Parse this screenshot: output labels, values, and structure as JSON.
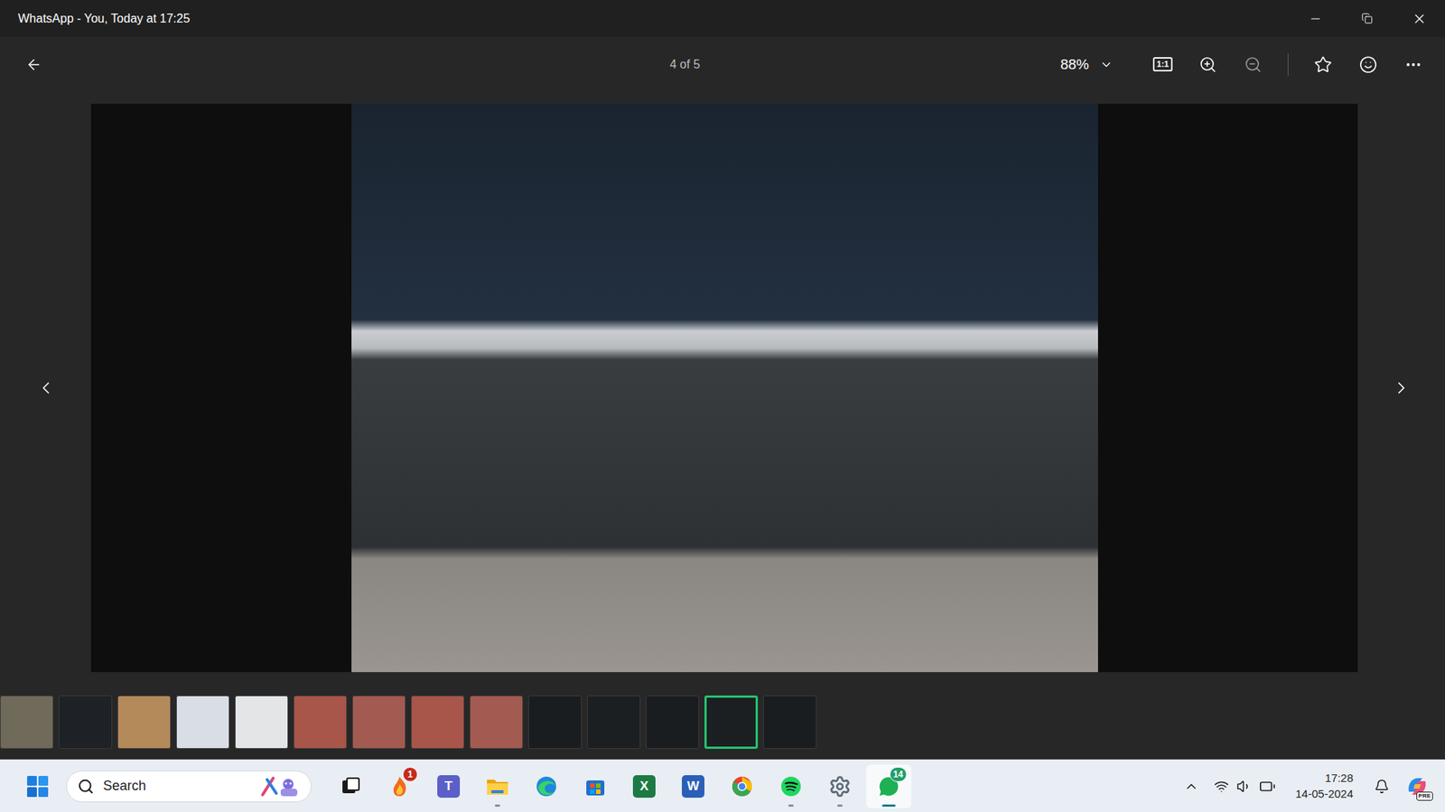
{
  "window": {
    "title": "WhatsApp - You, Today at 17:25"
  },
  "toolbar": {
    "position": "4 of 5",
    "zoom": "88%",
    "actual_size": "1:1"
  },
  "thumbnails": [
    {
      "selected": false,
      "color": "#6f6a5a"
    },
    {
      "selected": false,
      "color": "#1e2226"
    },
    {
      "selected": false,
      "color": "#b58a5a"
    },
    {
      "selected": false,
      "color": "#d8dde6"
    },
    {
      "selected": false,
      "color": "#e3e5e7"
    },
    {
      "selected": false,
      "color": "#a8554a"
    },
    {
      "selected": false,
      "color": "#a35a50"
    },
    {
      "selected": false,
      "color": "#a8554a"
    },
    {
      "selected": false,
      "color": "#a35a50"
    },
    {
      "selected": false,
      "color": "#1a1d20"
    },
    {
      "selected": false,
      "color": "#1c1f22"
    },
    {
      "selected": false,
      "color": "#1a1d20"
    },
    {
      "selected": true,
      "color": "#1c1f22"
    },
    {
      "selected": false,
      "color": "#1a1d20"
    }
  ],
  "taskbar": {
    "search": {
      "placeholder": "Search"
    },
    "apps": [
      {
        "kind": "taskview",
        "running": false,
        "active": false
      },
      {
        "kind": "fire",
        "badge": "1",
        "running": false,
        "active": false
      },
      {
        "kind": "teams",
        "glyph": "T",
        "running": false,
        "active": false
      },
      {
        "kind": "explorer",
        "running": true,
        "active": false
      },
      {
        "kind": "edge",
        "running": false,
        "active": false
      },
      {
        "kind": "store",
        "running": false,
        "active": false
      },
      {
        "kind": "excel",
        "glyph": "X",
        "running": false,
        "active": false
      },
      {
        "kind": "word",
        "glyph": "W",
        "running": false,
        "active": false
      },
      {
        "kind": "chrome",
        "running": false,
        "active": false
      },
      {
        "kind": "spotify",
        "running": true,
        "active": false
      },
      {
        "kind": "settings",
        "running": true,
        "active": false
      },
      {
        "kind": "whatsapp",
        "badge": "14",
        "running": true,
        "active": true
      }
    ],
    "tray": {
      "time": "17:28",
      "date": "14-05-2024",
      "copilot_badge": "PRE"
    }
  }
}
